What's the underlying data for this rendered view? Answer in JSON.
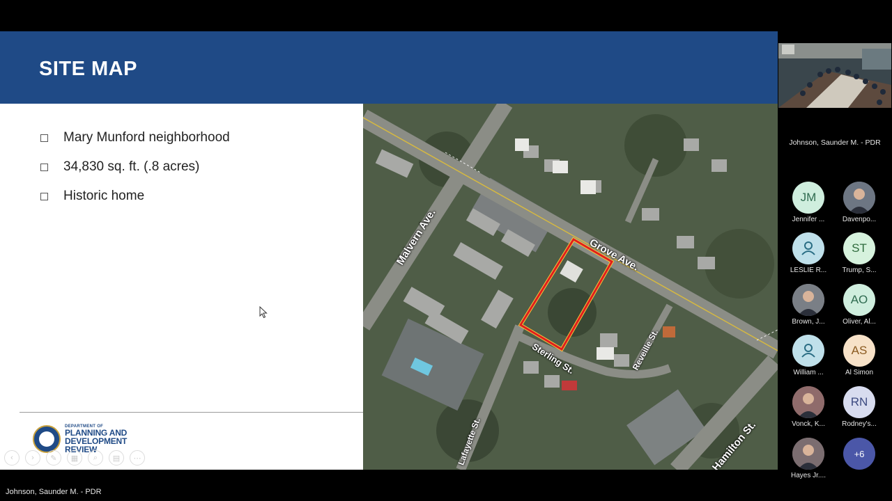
{
  "slide": {
    "title": "SITE MAP",
    "bullets": [
      "Mary Munford neighborhood",
      "34,830 sq. ft. (.8 acres)",
      "Historic home"
    ],
    "logo": {
      "dept": "DEPARTMENT OF",
      "line1": "PLANNING AND",
      "line2": "DEVELOPMENT",
      "line3": "REVIEW"
    },
    "map_labels": {
      "malvern": "Malvern Ave.",
      "grove": "Grove Ave.",
      "reveille": "Reveille St.",
      "sterling": "Sterling St.",
      "lafayette": "Lafayette St.",
      "hamilton": "N. Hamilton St."
    },
    "colors": {
      "header": "#1f4a86",
      "parcel_outline": "#e01e1e"
    }
  },
  "presenter": {
    "label": "Johnson, Saunder M. - PDR"
  },
  "sidebar": {
    "room_name": "Johnson, Saunder M. - PDR",
    "participants": [
      {
        "initials": "JM",
        "name": "Jennifer ...",
        "bg": "#cfeede",
        "fg": "#2f6b50",
        "type": "initials"
      },
      {
        "initials": "",
        "name": "Davenpo...",
        "bg": "#6d7683",
        "fg": "#fff",
        "type": "photo"
      },
      {
        "initials": "",
        "name": "LESLIE R...",
        "bg": "#bfe0ea",
        "fg": "#2a6d84",
        "type": "generic-person-icon"
      },
      {
        "initials": "ST",
        "name": "Trump, S...",
        "bg": "#d6f2dd",
        "fg": "#2f6b3d",
        "type": "initials"
      },
      {
        "initials": "",
        "name": "Brown, J...",
        "bg": "#7a7f86",
        "fg": "#fff",
        "type": "photo"
      },
      {
        "initials": "AO",
        "name": "Oliver, Al...",
        "bg": "#cfeede",
        "fg": "#2f6b50",
        "type": "initials"
      },
      {
        "initials": "",
        "name": "William ...",
        "bg": "#bfe0ea",
        "fg": "#2a6d84",
        "type": "generic-person-icon"
      },
      {
        "initials": "AS",
        "name": "Al Simon",
        "bg": "#f7e2c8",
        "fg": "#8a5a20",
        "type": "initials"
      },
      {
        "initials": "",
        "name": "Vonck, K...",
        "bg": "#8f6b6b",
        "fg": "#fff",
        "type": "photo"
      },
      {
        "initials": "RN",
        "name": "Rodney's...",
        "bg": "#d8dcef",
        "fg": "#3c4a80",
        "type": "initials"
      },
      {
        "initials": "",
        "name": "Hayes Jr....",
        "bg": "#7b6d70",
        "fg": "#fff",
        "type": "photo"
      },
      {
        "initials": "+6",
        "name": "",
        "bg": "#4b57a8",
        "fg": "#ffffff",
        "type": "overflow"
      }
    ]
  }
}
